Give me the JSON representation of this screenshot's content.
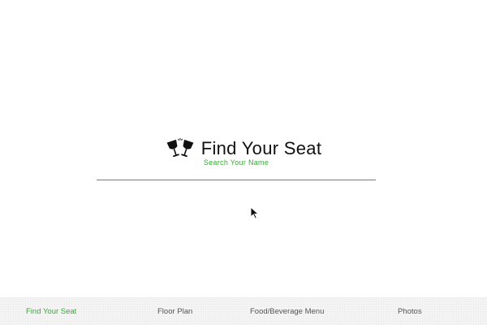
{
  "hero": {
    "icon": "cheers-glasses-icon",
    "title": "Find Your Seat"
  },
  "search": {
    "label": "Search Your Name",
    "value": "",
    "placeholder": ""
  },
  "nav": {
    "items": [
      {
        "label": "Find Your Seat",
        "active": true
      },
      {
        "label": "Floor Plan",
        "active": false
      },
      {
        "label": "Food/Beverage Menu",
        "active": false
      },
      {
        "label": "Photos",
        "active": false
      }
    ]
  },
  "colors": {
    "accent": "#3aa83a",
    "text": "#111111",
    "nav_text": "#555555",
    "nav_background": "#f4f4f4"
  }
}
